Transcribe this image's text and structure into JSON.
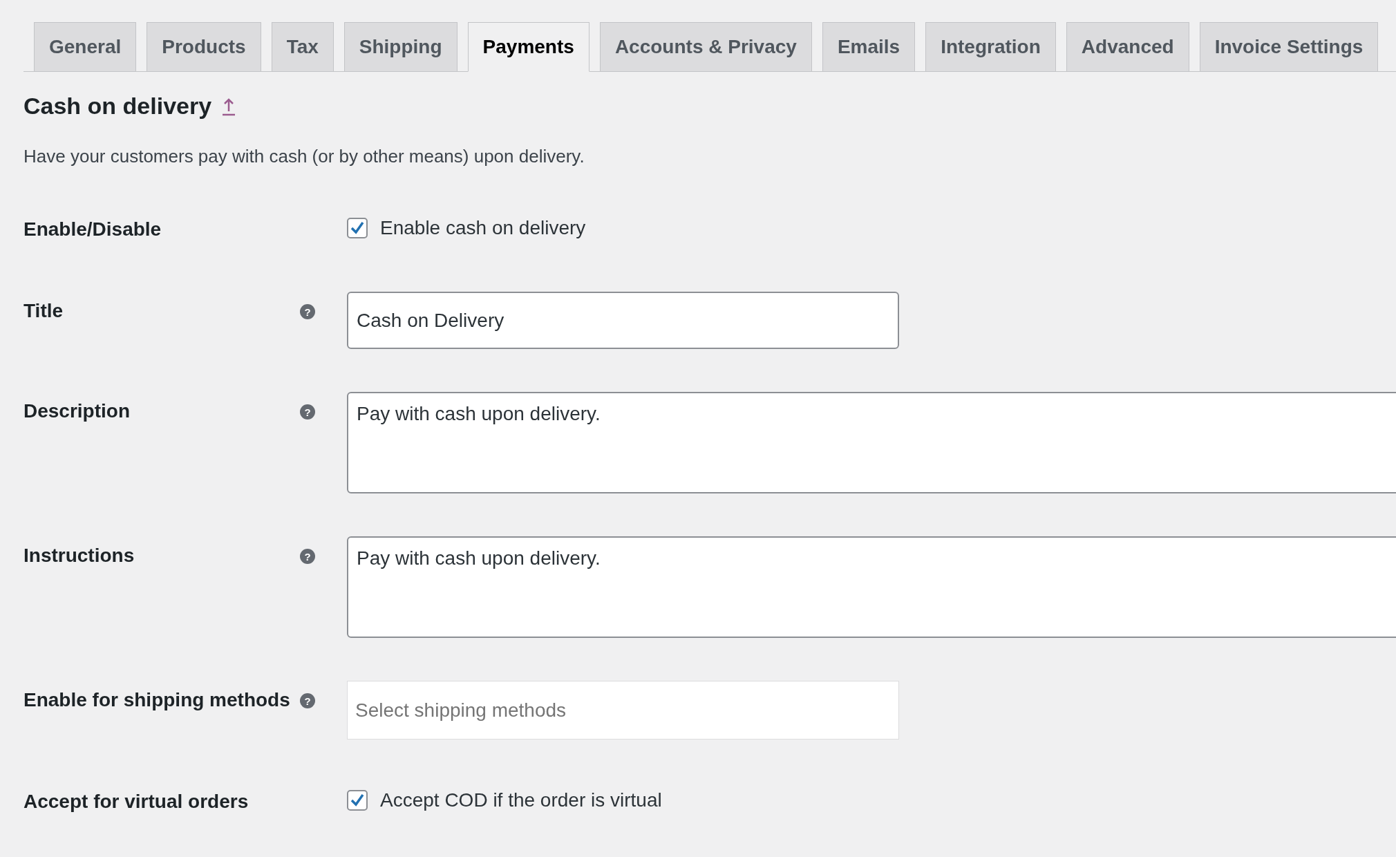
{
  "tabs": [
    {
      "label": "General",
      "selected": false
    },
    {
      "label": "Products",
      "selected": false
    },
    {
      "label": "Tax",
      "selected": false
    },
    {
      "label": "Shipping",
      "selected": false
    },
    {
      "label": "Payments",
      "selected": true
    },
    {
      "label": "Accounts & Privacy",
      "selected": false
    },
    {
      "label": "Emails",
      "selected": false
    },
    {
      "label": "Integration",
      "selected": false
    },
    {
      "label": "Advanced",
      "selected": false
    },
    {
      "label": "Invoice Settings",
      "selected": false
    }
  ],
  "section": {
    "title": "Cash on delivery",
    "description": "Have your customers pay with cash (or by other means) upon delivery."
  },
  "fields": [
    {
      "kind": "checkbox",
      "label": "Enable/Disable",
      "checked": true,
      "text": "Enable cash on delivery"
    },
    {
      "kind": "text",
      "label": "Title",
      "help": "?",
      "value": "Cash on Delivery"
    },
    {
      "kind": "textarea",
      "label": "Description",
      "help": "?",
      "value": "Pay with cash upon delivery."
    },
    {
      "kind": "textarea",
      "label": "Instructions",
      "help": "?",
      "value": "Pay with cash upon delivery."
    },
    {
      "kind": "select",
      "label": "Enable for shipping methods",
      "help": "?",
      "placeholder": "Select shipping methods"
    },
    {
      "kind": "checkbox",
      "label": "Accept for virtual orders",
      "checked": true,
      "text": "Accept COD if the order is virtual"
    }
  ]
}
